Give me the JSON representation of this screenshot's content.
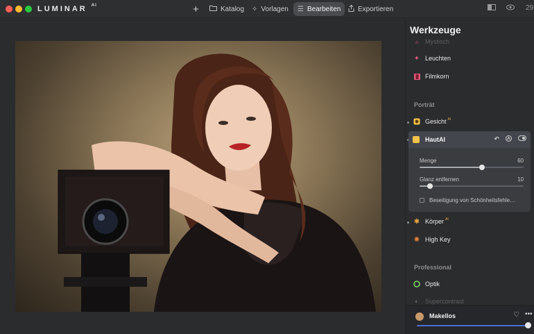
{
  "app": {
    "logo": "LUMINAR",
    "logo_suffix": "AI"
  },
  "nav": {
    "add_label": "+",
    "katalog": "Katalog",
    "vorlagen": "Vorlagen",
    "bearbeiten": "Bearbeiten",
    "exportieren": "Exportieren",
    "zoom": "29"
  },
  "panel": {
    "title": "Werkzeuge",
    "items_top": [
      {
        "label": "Mystisch",
        "icon": "mystic-icon",
        "color": "#e05a7a"
      },
      {
        "label": "Leuchten",
        "icon": "sparkle-icon",
        "color": "#e05a7a"
      },
      {
        "label": "Filmkorn",
        "icon": "film-icon",
        "color": "#e05a7a"
      }
    ],
    "section_portrait": "Porträt",
    "gesicht": {
      "label": "Gesicht",
      "ai": "AI"
    },
    "haut": {
      "label": "Haut",
      "ai": "AI",
      "sliders": [
        {
          "label": "Menge",
          "value": "60",
          "fraction": 0.6
        },
        {
          "label": "Glanz entfernen",
          "value": "10",
          "fraction": 0.1
        }
      ],
      "checkbox_label": "Beseitigung von Schönheitsfehle…"
    },
    "koerper": {
      "label": "Körper",
      "ai": "AI"
    },
    "high_key": {
      "label": "High Key"
    },
    "section_professional": "Professional",
    "optik": {
      "label": "Optik"
    },
    "faded_item": {
      "label": "Supercontrast"
    }
  },
  "bottom": {
    "preset_label": "Makellos",
    "slider_fraction": 0.97
  },
  "colors": {
    "accent_blue": "#4a6fd6",
    "ai_badge": "#e8a845",
    "haut_icon": "#f5c24a",
    "optik_ring": "#7fd66a"
  }
}
